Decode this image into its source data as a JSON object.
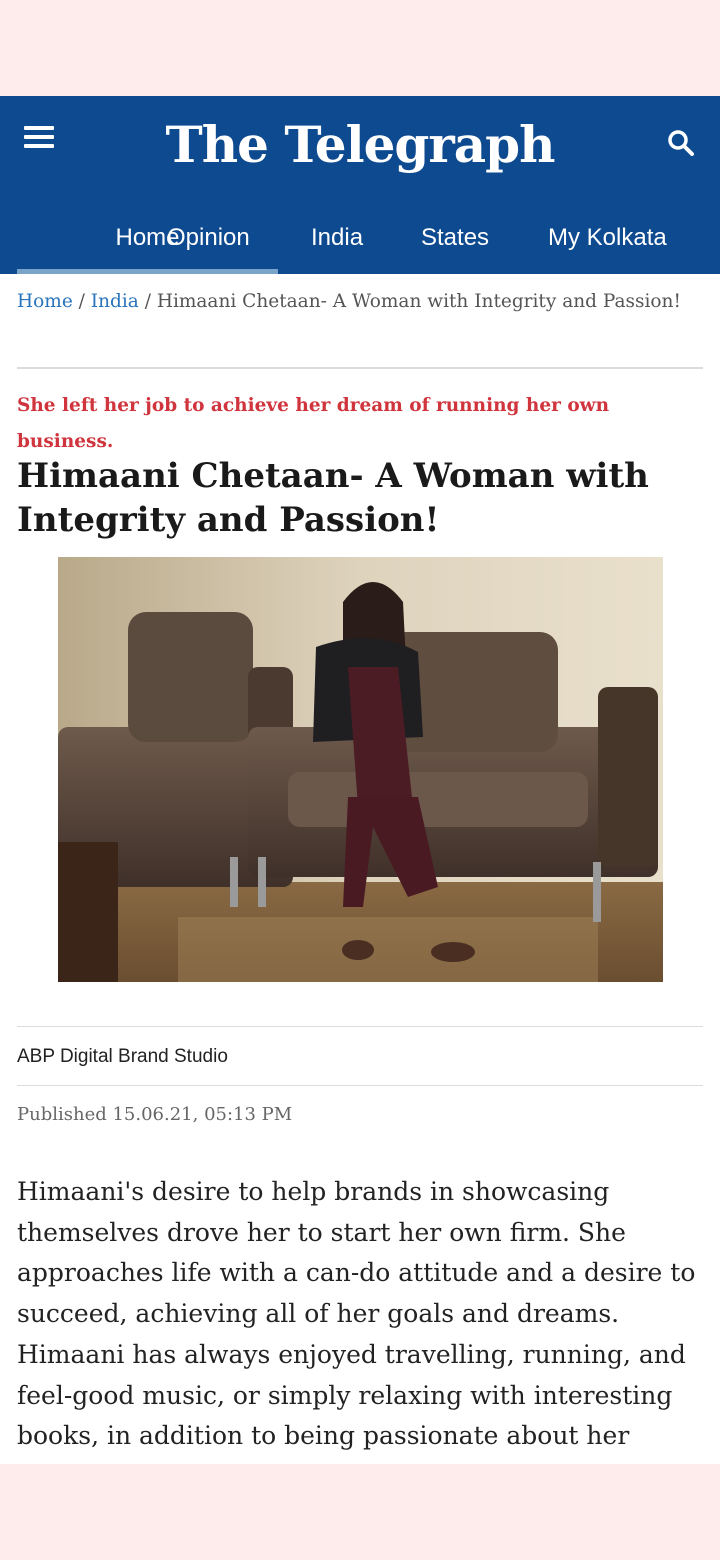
{
  "header": {
    "logo": "The Telegraph",
    "menu_icon": "hamburger-menu-icon",
    "search_icon": "search-icon",
    "bg_color": "#0e4a8f",
    "nav": [
      {
        "label": "Home",
        "active": true
      },
      {
        "label": "Opinion"
      },
      {
        "label": "India"
      },
      {
        "label": "States"
      },
      {
        "label": "My Kolkata"
      }
    ]
  },
  "breadcrumb": {
    "home": "Home",
    "sep1": "/",
    "section": "India",
    "sep2": "/",
    "current": "Himaani Chetaan- A Woman with Integrity and Passion!"
  },
  "article": {
    "kicker": "She left her job to achieve her dream of running her own business.",
    "headline": "Himaani Chetaan- A Woman with Integrity and Passion!",
    "byline": "ABP Digital Brand Studio",
    "published": "Published 15.06.21, 05:13 PM",
    "body": "Himaani's desire to help brands in showcasing themselves drove her to start her own firm. She approaches life with a can-do attitude and a desire to succeed, achieving all of her goals and dreams. Himaani has always enjoyed travelling, running, and feel-good music, or simply relaxing with interesting books, in addition to being passionate about her",
    "kicker_color": "#d0343d",
    "link_color": "#2a74bd"
  }
}
